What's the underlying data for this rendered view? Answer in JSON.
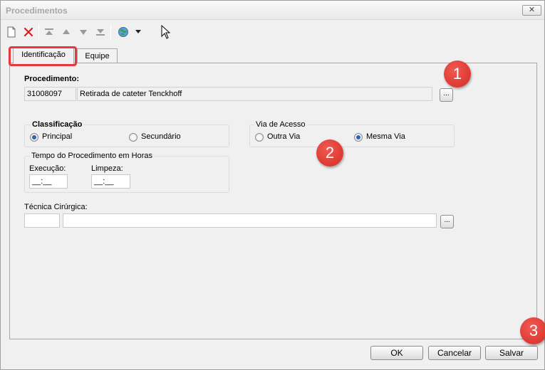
{
  "window": {
    "title": "Procedimentos",
    "close_label": "✕"
  },
  "toolbar": {
    "icons": [
      "new-document-icon",
      "delete-icon",
      "move-first-icon",
      "move-up-icon",
      "move-down-icon",
      "move-last-icon",
      "globe-icon",
      "dropdown-arrow-icon"
    ],
    "delete_color": "#d92020"
  },
  "tabs": [
    {
      "label": "Identificação",
      "active": true
    },
    {
      "label": "Equipe",
      "active": false
    }
  ],
  "procedimento": {
    "label": "Procedimento:",
    "code": "31008097",
    "description": "Retirada de cateter Tenckhoff",
    "lookup_label": "..."
  },
  "classificacao": {
    "label": "Classificação",
    "options": [
      {
        "label": "Principal",
        "checked": true
      },
      {
        "label": "Secundário",
        "checked": false
      }
    ]
  },
  "via_acesso": {
    "label": "Via de Acesso",
    "options": [
      {
        "label": "Outra Via",
        "checked": false
      },
      {
        "label": "Mesma Via",
        "checked": true
      }
    ]
  },
  "tempo": {
    "label": "Tempo do Procedimento em Horas",
    "execucao_label": "Execução:",
    "execucao_value": "__:__",
    "limpeza_label": "Limpeza:",
    "limpeza_value": "__:__"
  },
  "tecnica": {
    "label": "Técnica Cirúrgica:",
    "code": "",
    "description": "",
    "lookup_label": "..."
  },
  "badges": [
    "1",
    "2",
    "3"
  ],
  "badge_color": "#e0322b",
  "highlight_color": "#e8373a",
  "buttons": {
    "ok": "OK",
    "cancel": "Cancelar",
    "save": "Salvar"
  }
}
